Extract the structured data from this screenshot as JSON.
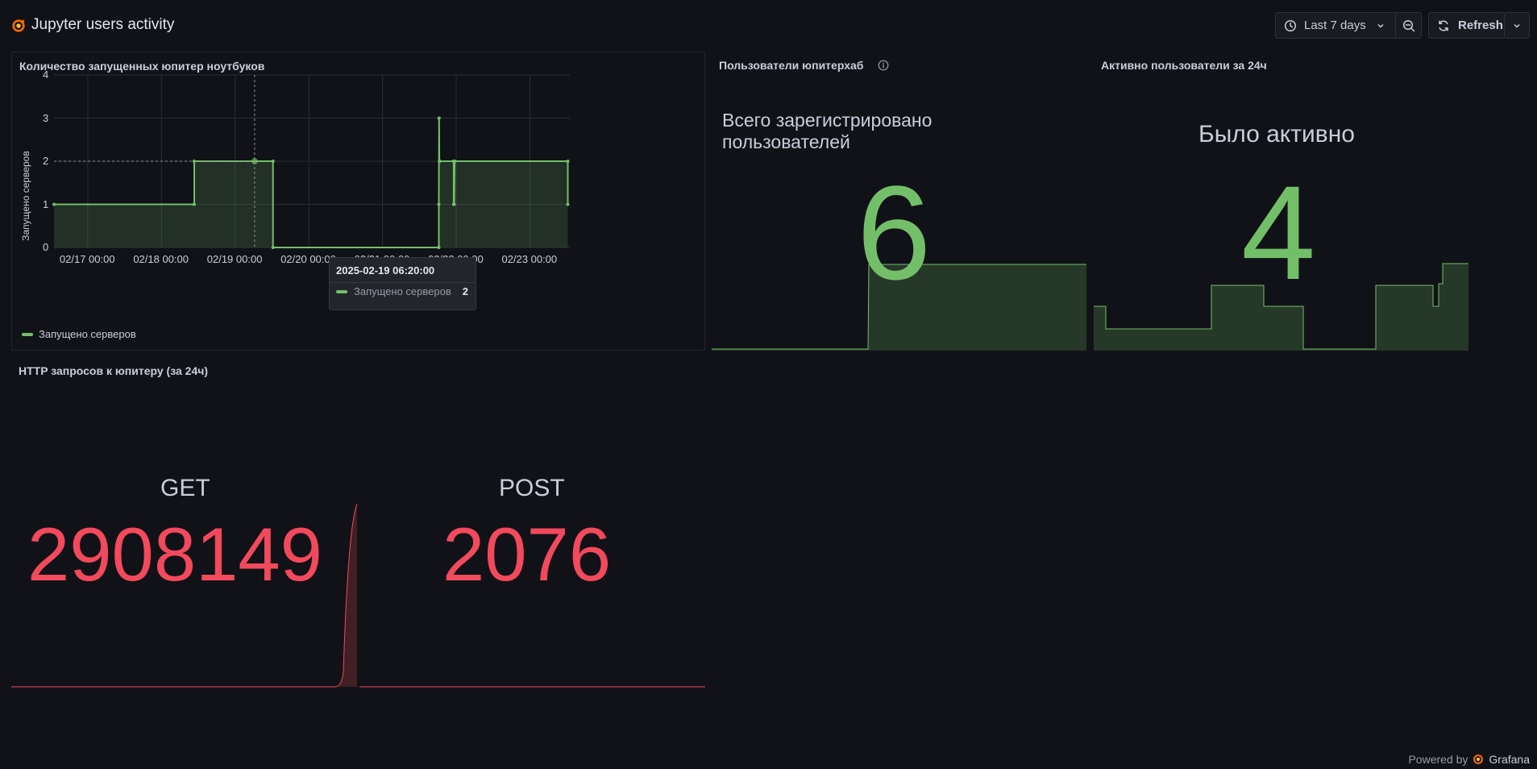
{
  "header": {
    "title": "Jupyter users activity",
    "time_range_label": "Last 7 days",
    "refresh_label": "Refresh"
  },
  "panels": {
    "notebooks": {
      "title": "Количество запущенных юпитер ноутбуков",
      "y_axis_label": "Запущено серверов",
      "tooltip_time": "2025-02-19 06:20:00",
      "tooltip_series": "Запущено серверов",
      "tooltip_value": "2",
      "legend_label": "Запущено серверов"
    },
    "users": {
      "title": "Пользователи юпитерхаб",
      "info_icon": "info-circle-icon",
      "stat_label_line1": "Всего зарегистрировано",
      "stat_label_line2": "пользователей",
      "value": "6"
    },
    "active": {
      "title": "Активно пользователи за 24ч",
      "stat_label": "Было активно",
      "value": "4"
    },
    "http": {
      "title": "HTTP запросов к юпитеру (за 24ч)",
      "get_label": "GET",
      "get_value": "2908149",
      "post_label": "POST",
      "post_value": "2076"
    }
  },
  "footer": {
    "powered_by": "Powered by",
    "brand": "Grafana"
  },
  "colors": {
    "green": "#73bf69",
    "red": "#f2495c",
    "background": "#111217"
  },
  "chart_data": {
    "type": "line",
    "title": "Количество запущенных юпитер ноутбуков",
    "ylabel": "Запущено серверов",
    "xlabel": "",
    "x_ticks": [
      "02/17 00:00",
      "02/18 00:00",
      "02/19 00:00",
      "02/20 00:00",
      "02/21 00:00",
      "02/22 00:00",
      "02/23 00:00"
    ],
    "y_ticks": [
      0,
      1,
      2,
      3,
      4
    ],
    "ylim": [
      0,
      4
    ],
    "xlim_days": [
      "2025-02-16 13:00",
      "2025-02-23 13:00"
    ],
    "grid": true,
    "legend": "bottom-left",
    "series": [
      {
        "name": "Запущено серверов",
        "color": "#73bf69",
        "x": [
          "2025-02-16 13:00",
          "2025-02-18 10:40",
          "2025-02-18 10:40",
          "2025-02-19 12:20",
          "2025-02-19 12:20",
          "2025-02-21 18:20",
          "2025-02-21 18:20",
          "2025-02-21 18:25",
          "2025-02-21 18:30",
          "2025-02-21 18:40",
          "2025-02-21 23:10",
          "2025-02-21 23:10",
          "2025-02-21 23:20",
          "2025-02-21 23:30",
          "2025-02-23 12:20",
          "2025-02-23 12:20"
        ],
        "values": [
          1,
          1,
          2,
          2,
          0,
          0,
          1,
          3,
          2,
          2,
          2,
          1,
          1,
          2,
          2,
          1
        ]
      }
    ]
  }
}
